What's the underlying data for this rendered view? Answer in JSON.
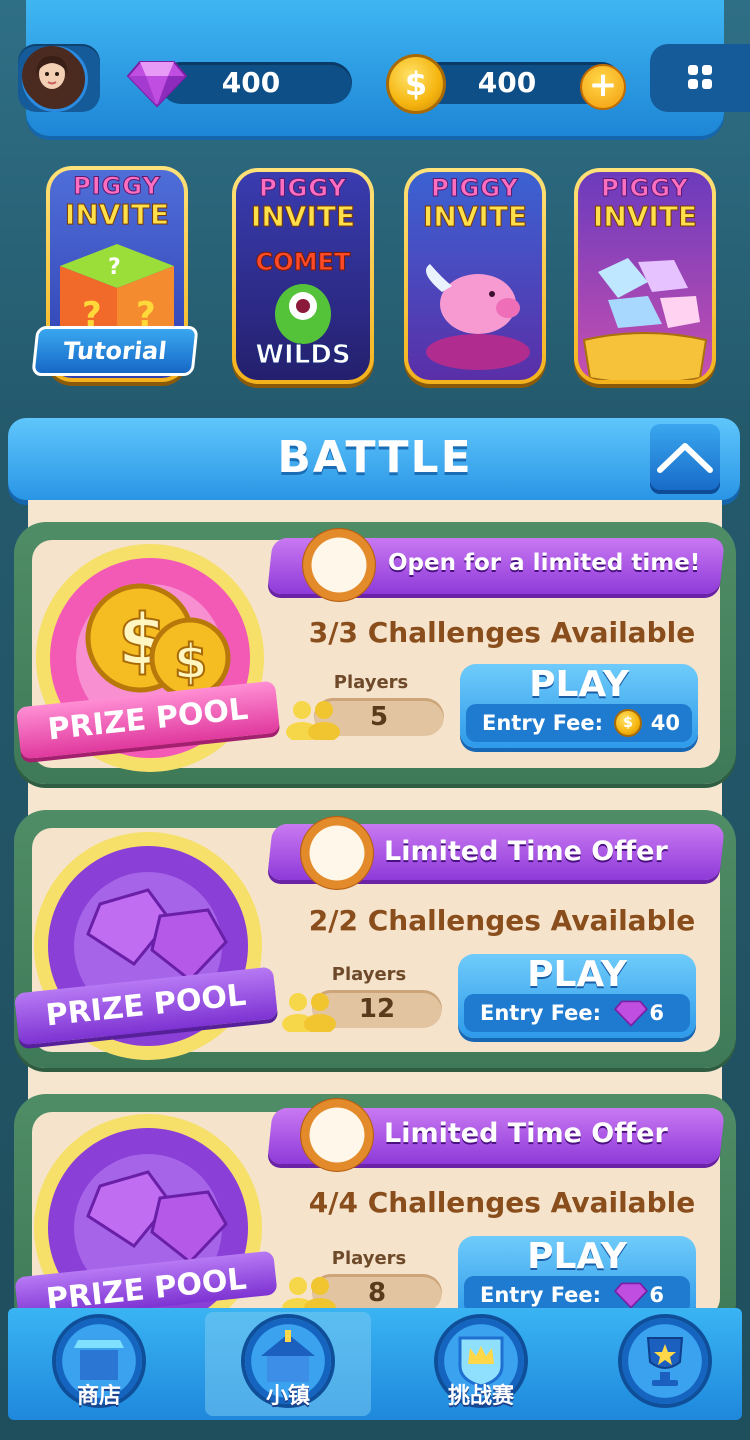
{
  "header": {
    "gems": "400",
    "coins": "400",
    "coin_symbol": "$",
    "plus": "+"
  },
  "games": [
    {
      "logo_top": "PIGGY",
      "logo_bottom": "INVITE",
      "badge": "Tutorial",
      "art": "mystery-box"
    },
    {
      "logo_top": "PIGGY",
      "logo_bottom": "INVITE",
      "art_text_top": "COMET",
      "art_text_bottom": "WILDS"
    },
    {
      "logo_top": "PIGGY",
      "logo_bottom": "INVITE",
      "art": "flying-pig"
    },
    {
      "logo_top": "PIGGY",
      "logo_bottom": "INVITE",
      "art": "treasure-gems"
    }
  ],
  "battle": {
    "title": "BATTLE",
    "cards": [
      {
        "ribbon": "Open for a limited time!",
        "challenges": "3/3 Challenges Available",
        "players_label": "Players",
        "players": "5",
        "play": "PLAY",
        "fee_label": "Entry Fee:",
        "fee": "40",
        "currency": "coin",
        "prize": "PRIZE POOL"
      },
      {
        "ribbon": "Limited Time Offer",
        "challenges": "2/2 Challenges Available",
        "players_label": "Players",
        "players": "12",
        "play": "PLAY",
        "fee_label": "Entry Fee:",
        "fee": "6",
        "currency": "gem",
        "prize": "PRIZE POOL"
      },
      {
        "ribbon": "Limited Time Offer",
        "challenges": "4/4 Challenges Available",
        "players_label": "Players",
        "players": "8",
        "play": "PLAY",
        "fee_label": "Entry Fee:",
        "fee": "6",
        "currency": "gem",
        "prize": "PRIZE POOL"
      }
    ]
  },
  "nav": {
    "items": [
      {
        "label": "商店",
        "icon": "shop-icon"
      },
      {
        "label": "小镇",
        "icon": "town-icon",
        "active": true
      },
      {
        "label": "挑战赛",
        "icon": "challenge-icon"
      },
      {
        "label": "",
        "icon": "trophy-icon"
      }
    ]
  },
  "colors": {
    "accent_blue": "#2a95e6",
    "card_green": "#4f8d66",
    "ribbon_purple": "#8e3ad9",
    "coin_gold": "#f5b40e"
  }
}
